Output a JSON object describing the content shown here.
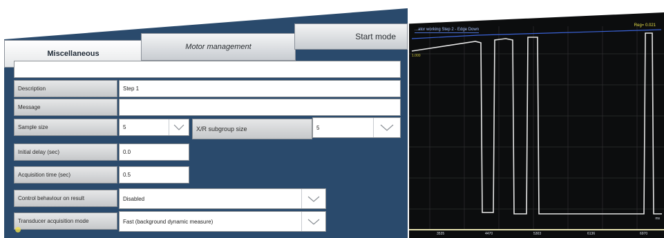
{
  "tabs": [
    {
      "label": "Miscellaneous",
      "active": true
    },
    {
      "label": "Motor management",
      "active": false
    },
    {
      "label": "Start mode",
      "active": false
    }
  ],
  "form": {
    "description": {
      "label": "Description",
      "value": "Step 1"
    },
    "message": {
      "label": "Message",
      "value": ""
    },
    "sample_size": {
      "label": "Sample size",
      "value": "5"
    },
    "xr_subgroup": {
      "label": "X/R subgroup size",
      "value": "5"
    },
    "initial_delay": {
      "label": "Initial delay (sec)",
      "value": "0.0"
    },
    "acquisition_time": {
      "label": "Acquisition time (sec)",
      "value": "0.5"
    },
    "control_behaviour": {
      "label": "Control behaviour on result",
      "value": "Disabled"
    },
    "transducer_mode": {
      "label": "Transducer acquisition mode",
      "value": "Fast (background dynamic measure)"
    }
  },
  "graph": {
    "title": "...ator working Step 2 - Edge Down",
    "readout": "Reg= 0.021",
    "x_ticks": [
      "3535",
      "4470",
      "5303",
      "6136",
      "6970"
    ],
    "unit": "ms",
    "colors": {
      "trace": "#e6e6e6",
      "reference": "#3b63d8",
      "axis": "#e8e4b0"
    }
  }
}
